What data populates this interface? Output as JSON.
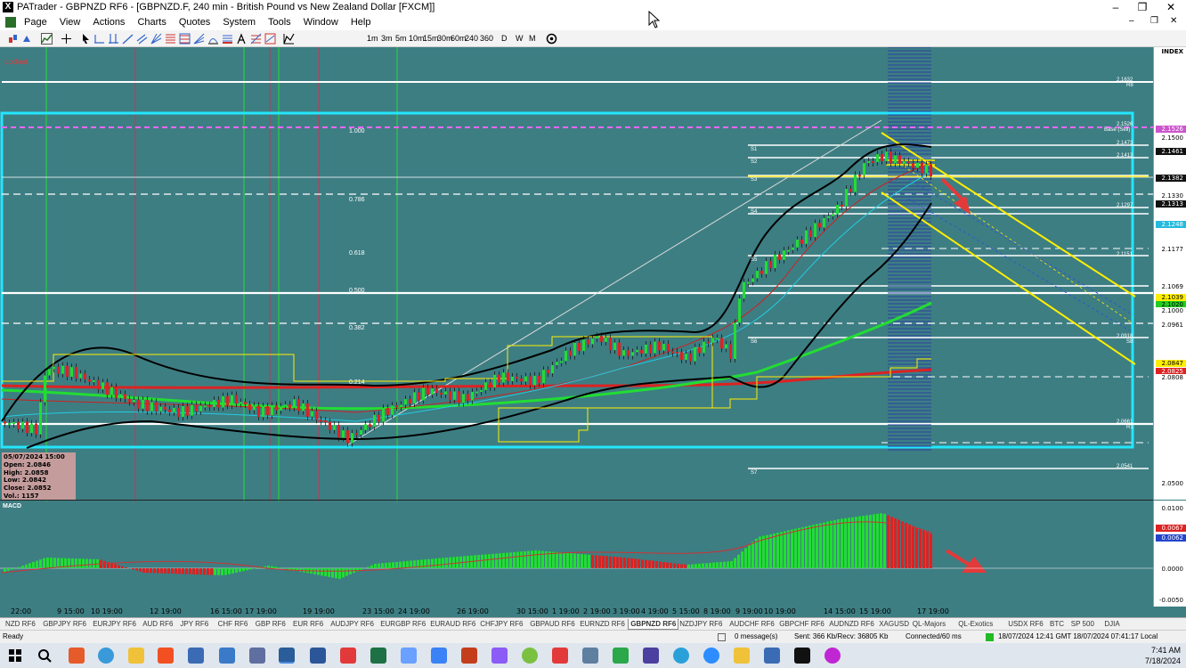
{
  "window": {
    "title": "PATrader - GBPNZD RF6 - [GBPNZD.F, 240 min - British Pound vs New Zealand Dollar [FXCM]]",
    "controls": [
      "–",
      "❐",
      "✕"
    ]
  },
  "menu": [
    "Page",
    "View",
    "Actions",
    "Charts",
    "Quotes",
    "System",
    "Tools",
    "Window",
    "Help"
  ],
  "timeframes": [
    "1m",
    "3m",
    "5m",
    "10m",
    "15m",
    "30m",
    "60m",
    "240",
    "360",
    "D",
    "W",
    "M"
  ],
  "chart": {
    "locked_label": "Locked",
    "index_label": "INDEX",
    "fib_labels": [
      "1.000",
      "0.786",
      "0.618",
      "0.500",
      "0.382",
      "0.214"
    ],
    "pivot_labels": [
      "S1",
      "S2",
      "S3",
      "S4",
      "S5",
      "S6",
      "S7"
    ],
    "level_labels": [
      "2.1632",
      "2.1526",
      "2.1473",
      "2.1413",
      "2.1297",
      "2.1151",
      "2.0918",
      "2.0661",
      "2.0541"
    ],
    "level_tags": {
      "r8": "R8",
      "base": "Base (Sell)",
      "s8": "S8",
      "r1": "R1"
    },
    "price_axis": [
      {
        "v": "2.1526",
        "bg": "#cc55cc",
        "fg": "#ffffff"
      },
      {
        "v": "2.1500",
        "bg": "#ffffff",
        "fg": "#000000"
      },
      {
        "v": "2.1461",
        "bg": "#111111",
        "fg": "#ffffff"
      },
      {
        "v": "2.1382",
        "bg": "#111111",
        "fg": "#ffffff"
      },
      {
        "v": "2.1330",
        "bg": "#ffffff",
        "fg": "#000000"
      },
      {
        "v": "2.1313",
        "bg": "#111111",
        "fg": "#ffffff"
      },
      {
        "v": "2.1248",
        "bg": "#22bbdd",
        "fg": "#ffffff"
      },
      {
        "v": "2.1177",
        "bg": "#ffffff",
        "fg": "#000000"
      },
      {
        "v": "2.1069",
        "bg": "#ffffff",
        "fg": "#000000"
      },
      {
        "v": "2.1039",
        "bg": "#ffee00",
        "fg": "#000000"
      },
      {
        "v": "2.1020",
        "bg": "#22cc22",
        "fg": "#000000"
      },
      {
        "v": "2.1000",
        "bg": "#ffffff",
        "fg": "#000000"
      },
      {
        "v": "2.0961",
        "bg": "#ffffff",
        "fg": "#000000"
      },
      {
        "v": "2.0847",
        "bg": "#ffee00",
        "fg": "#000000"
      },
      {
        "v": "2.0825",
        "bg": "#dd2222",
        "fg": "#ffffff"
      },
      {
        "v": "2.0808",
        "bg": "#ffffff",
        "fg": "#000000"
      },
      {
        "v": "2.0500",
        "bg": "#ffffff",
        "fg": "#000000"
      }
    ],
    "ohlc": {
      "date": "05/07/2024 15:00",
      "open": "Open: 2.0846",
      "high": "High: 2.0858",
      "low": "Low: 2.0842",
      "close": "Close: 2.0852",
      "vol": "Vol.: 1157"
    }
  },
  "macd": {
    "label": "MACD",
    "axis": [
      {
        "v": "0.0100",
        "bg": "#ffffff",
        "fg": "#000000"
      },
      {
        "v": "0.0067",
        "bg": "#dd2222",
        "fg": "#ffffff"
      },
      {
        "v": "0.0062",
        "bg": "#2244cc",
        "fg": "#ffffff"
      },
      {
        "v": "0.0000",
        "bg": "#ffffff",
        "fg": "#000000"
      },
      {
        "v": "-0.0050",
        "bg": "#ffffff",
        "fg": "#000000"
      }
    ]
  },
  "time_axis": [
    "22:00",
    "9 15:00",
    "10 19:00",
    "12 19:00",
    "16 15:00",
    "17 19:00",
    "19 19:00",
    "23 15:00",
    "24 19:00",
    "26 19:00",
    "30 15:00",
    "1 19:00",
    "2 19:00",
    "3 19:00",
    "4 19:00",
    "5 15:00",
    "8 19:00",
    "9 19:00",
    "10 19:00",
    "14 15:00",
    "15 19:00",
    "17 19:00"
  ],
  "tabs": [
    "NZD RF6",
    "GBPJPY RF6",
    "EURJPY RF6",
    "AUD RF6",
    "JPY RF6",
    "CHF RF6",
    "GBP RF6",
    "EUR RF6",
    "AUDJPY RF6",
    "EURGBP RF6",
    "EURAUD RF6",
    "CHFJPY RF6",
    "GBPAUD RF6",
    "EURNZD RF6",
    "GBPNZD RF6",
    "NZDJPY RF6",
    "AUDCHF RF6",
    "GBPCHF RF6",
    "AUDNZD RF6",
    "XAGUSD",
    "QL-Majors",
    "QL-Exotics",
    "USDX RF6",
    "BTC",
    "SP 500",
    "DJIA"
  ],
  "active_tab": "GBPNZD RF6",
  "status": {
    "ready": "Ready",
    "messages": "0 message(s)",
    "sent": "Sent: 366 Kb/Recv: 36805 Kb",
    "connected": "Connected/60 ms",
    "datetime": "18/07/2024 12:41 GMT  18/07/2024 07:41:17 Local"
  },
  "clock": {
    "time": "7:41 AM",
    "date": "7/18/2024"
  },
  "colors": {
    "chart_bg": "#3d7e83",
    "bull": "#22dd33",
    "bear": "#dd2222",
    "fib": "#ffffff",
    "channel": "#ffee00",
    "box": "#22e6ff"
  }
}
